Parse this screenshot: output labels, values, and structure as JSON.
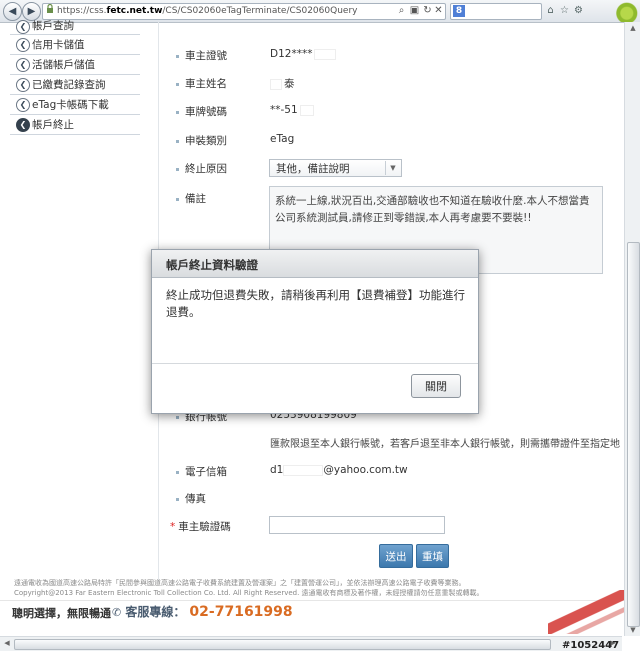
{
  "browser": {
    "url_prefix": "https://css.",
    "url_domain": "fetc.net.tw",
    "url_path": "/CS/CS02060eTagTerminate/CS02060Query",
    "back_glyph": "◀",
    "forward_glyph": "▶",
    "lock_icon": "padlock-icon",
    "search_engine_glyph": "8"
  },
  "sidebar": {
    "items": [
      {
        "label": "帳戶查詢"
      },
      {
        "label": "信用卡儲值"
      },
      {
        "label": "活儲帳戶儲值"
      },
      {
        "label": "已繳費記錄查詢"
      },
      {
        "label": "eTag卡帳碼下載"
      },
      {
        "label": "帳戶終止"
      }
    ],
    "active_index": 5
  },
  "form": {
    "owner_id_label": "車主證號",
    "owner_id_value": "D12****",
    "owner_name_label": "車主姓名",
    "owner_name_value": "泰",
    "plate_label": "車牌號碼",
    "plate_value": "**-51",
    "type_label": "申裝類別",
    "type_value": "eTag",
    "reason_label": "終止原因",
    "reason_value": "其他，備註說明",
    "note_label": "備註",
    "note_value": "系統一上線,狀況百出,交通部驗收也不知道在驗收什麼.本人不想當貴公司系統測試員,請修正到零錯誤,本人再考慮要不要裝!!",
    "bank_label": "銀行帳號",
    "bank_value": "0253908199809",
    "refund_hint": "匯款限退至本人銀行帳號，若客戶退至非本人銀行帳號，則需攜帶證件至指定地",
    "email_label": "電子信箱",
    "email_prefix": "d1",
    "email_suffix": "@yahoo.com.tw",
    "fax_label": "傳真",
    "captcha_label": "車主驗證碼",
    "required_mark": "*",
    "submit_label": "送出",
    "reset_label": "重填"
  },
  "footer": {
    "legal_line1": "遠通電收為國道高速公路局特許「民間參與國道高速公路電子收費系統建置及營運案」之「建置營運公司」，並依法辦理高速公路電子收費等業務。",
    "legal_line2": "Copyright@2013 Far Eastern Electronic Toll Collection Co. Ltd. All Right Reserved. 遠通電收有商標及著作權，未經授權請勿任意重製或轉載。",
    "slogan": "聰明選擇，無限暢通",
    "service_label": "客服專線：",
    "service_phone": "02-77161998"
  },
  "modal": {
    "title": "帳戶終止資料驗證",
    "message": "終止成功但退費失敗，請稍後再利用【退費補登】功能進行退費。",
    "close_label": "關閉"
  },
  "watermark": "#1052447"
}
